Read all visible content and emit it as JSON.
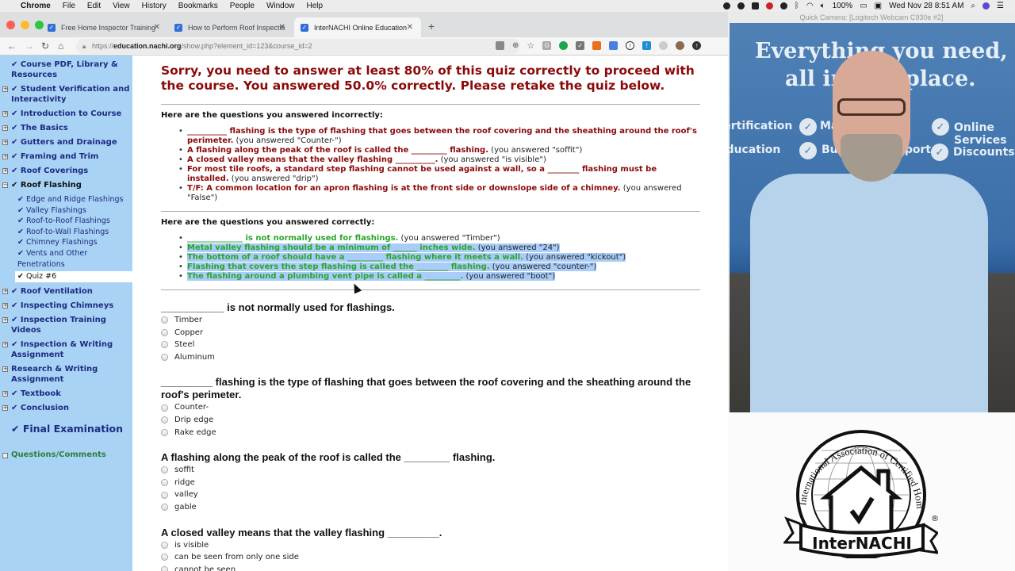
{
  "menubar": {
    "app": "Chrome",
    "items": [
      "File",
      "Edit",
      "View",
      "History",
      "Bookmarks",
      "People",
      "Window",
      "Help"
    ],
    "battery": "100%",
    "datetime": "Wed Nov 28  8:51 AM"
  },
  "browser": {
    "tabs": [
      {
        "title": "Free Home Inspector Training",
        "active": false
      },
      {
        "title": "How to Perform Roof Inspectio",
        "active": false
      },
      {
        "title": "InterNACHI Online Education",
        "active": true
      }
    ],
    "url_prefix": "https://",
    "url_domain": "education.nachi.org",
    "url_path": "/show.php?element_id=123&course_id=2"
  },
  "sidebar": {
    "items": [
      {
        "label": "✔ Course PDF, Library & Resources",
        "toggle": ""
      },
      {
        "label": "✔ Student Verification and Interactivity",
        "toggle": "+"
      },
      {
        "label": "✔ Introduction to Course",
        "toggle": "+"
      },
      {
        "label": "✔ The Basics",
        "toggle": "+"
      },
      {
        "label": "✔ Gutters and Drainage",
        "toggle": "+"
      },
      {
        "label": "✔ Framing and Trim",
        "toggle": "+"
      },
      {
        "label": "✔ Roof Coverings",
        "toggle": "+"
      },
      {
        "label": "✔ Roof Flashing",
        "toggle": "−"
      }
    ],
    "subitems": [
      "✔ Edge and Ridge Flashings",
      "✔ Valley Flashings",
      "✔ Roof-to-Roof Flashings",
      "✔ Roof-to-Wall Flashings",
      "✔ Chimney Flashings",
      "✔ Vents and Other Penetrations"
    ],
    "active_sub": "✔ Quiz #6",
    "items_after": [
      {
        "label": "✔ Roof Ventilation",
        "toggle": "+"
      },
      {
        "label": "✔ Inspecting Chimneys",
        "toggle": "+"
      },
      {
        "label": "✔ Inspection Training Videos",
        "toggle": "+"
      },
      {
        "label": "✔ Inspection & Writing Assignment",
        "toggle": "+"
      },
      {
        "label": "Research & Writing Assignment",
        "toggle": "+"
      },
      {
        "label": "✔ Textbook",
        "toggle": "+"
      },
      {
        "label": "✔ Conclusion",
        "toggle": "+"
      }
    ],
    "final_exam": "✔ Final Examination",
    "questions_comments": "Questions/Comments"
  },
  "main": {
    "result_message": "Sorry, you need to answer at least 80% of this quiz correctly to proceed with the course. You answered 50.0% correctly. Please retake the quiz below.",
    "required_percent": 80,
    "score_percent": 50.0,
    "incorrect_header": "Here are the questions you answered incorrectly:",
    "incorrect": [
      {
        "q": "__________ flashing is the type of flashing that goes between the roof covering and the sheathing around the roof's perimeter.",
        "a": " (you answered \"Counter-\")"
      },
      {
        "q": "A flashing along the peak of the roof is called the _________ flashing.",
        "a": " (you answered \"soffit\")"
      },
      {
        "q": "A closed valley means that the valley flashing __________.",
        "a": " (you answered \"is visible\")"
      },
      {
        "q": "For most tile roofs, a standard step flashing cannot be used against a wall, so a ________ flashing must be installed.",
        "a": " (you answered \"drip\")"
      },
      {
        "q": "T/F: A common location for an apron flashing is at the front side or downslope side of a chimney.",
        "a": " (you answered \"False\")"
      }
    ],
    "correct_header": "Here are the questions you answered correctly:",
    "correct": [
      {
        "q": "______________ is not normally used for flashings.",
        "a": " (you answered \"Timber\")"
      },
      {
        "q": "Metal valley flashing should be a minimum of ______ inches wide.",
        "a": " (you answered \"24\")"
      },
      {
        "q": "The bottom of a roof should have a _________ flashing where it meets a wall.",
        "a": " (you answered \"kickout\")"
      },
      {
        "q": "Flashing that covers the step flashing is called the ________ flashing.",
        "a": " (you answered \"counter-\")"
      },
      {
        "q": "The flashing around a plumbing vent pipe is called a _________.",
        "a": " (you answered \"boot\")"
      }
    ],
    "quiz": [
      {
        "question": "___________ is not normally used for flashings.",
        "options": [
          "Timber",
          "Copper",
          "Steel",
          "Aluminum"
        ]
      },
      {
        "question": "_________ flashing is the type of flashing that goes between the roof covering and the sheathing around the roof's perimeter.",
        "options": [
          "Counter-",
          "Drip edge",
          "Rake edge"
        ]
      },
      {
        "question": "A flashing along the peak of the roof is called the ________ flashing.",
        "options": [
          "soffit",
          "ridge",
          "valley",
          "gable"
        ]
      },
      {
        "question": "A closed valley means that the valley flashing _________.",
        "options": [
          "is visible",
          "can be seen from only one side",
          "cannot be seen"
        ]
      }
    ]
  },
  "camera": {
    "window_title": "Quick Camera: [Logitech Webcam C930e #2]",
    "banner_line1": "Everything you need,",
    "banner_line2": "all in one place.",
    "banner_items": [
      "Certification",
      "Marketing",
      "Online Services",
      "Education",
      "Business Support",
      "Discounts"
    ]
  },
  "logo": {
    "arc_text": "International Association of Certified Home Inspectors",
    "name": "InterNACHI",
    "registered": "®"
  },
  "colors": {
    "sidebar_bg": "#a9d3f5",
    "sidebar_link": "#1c2b84",
    "error_red": "#8b0a0a",
    "correct_green": "#2aa52a",
    "selection": "#a9cdf8"
  }
}
